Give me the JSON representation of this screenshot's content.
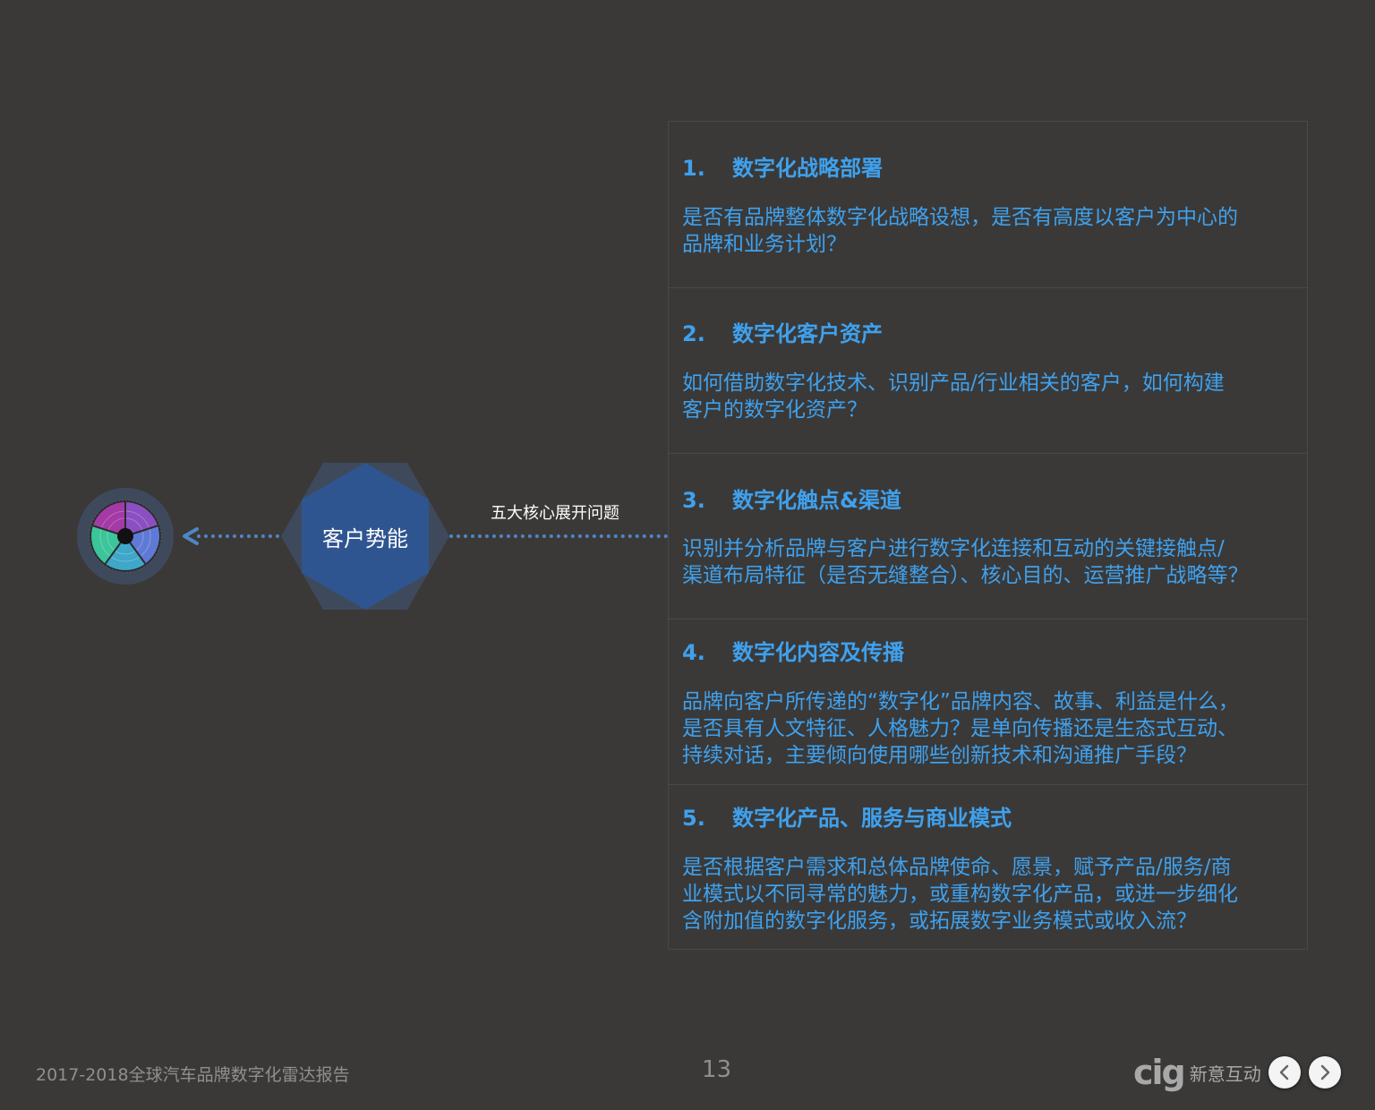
{
  "hub": {
    "label": "客户势能",
    "connector_caption": "五大核心展开问题"
  },
  "sections": [
    {
      "num": "1.",
      "title": "数字化战略部署",
      "body": "是否有品牌整体数字化战略设想，是否有高度以客户为中心的\n品牌和业务计划？"
    },
    {
      "num": "2.",
      "title": "数字化客户资产",
      "body": "如何借助数字化技术、识别产品/行业相关的客户，如何构建\n客户的数字化资产？"
    },
    {
      "num": "3.",
      "title": "数字化触点&渠道",
      "body": "识别并分析品牌与客户进行数字化连接和互动的关键接触点/\n渠道布局特征（是否无缝整合）、核心目的、运营推广战略等？"
    },
    {
      "num": "4.",
      "title": "数字化内容及传播",
      "body": "品牌向客户所传递的“数字化”品牌内容、故事、利益是什么，\n是否具有人文特征、人格魅力？是单向传播还是生态式互动、\n持续对话，主要倾向使用哪些创新技术和沟通推广手段？"
    },
    {
      "num": "5.",
      "title": "数字化产品、服务与商业模式",
      "body": "是否根据客户需求和总体品牌使命、愿景，赋予产品/服务/商\n业模式以不同寻常的魅力，或重构数字化产品，或进一步细化\n含附加值的数字化服务，或拓展数字业务模式或收入流？"
    }
  ],
  "footer": {
    "title": "2017-2018全球汽车品牌数字化雷达报告",
    "page": "13",
    "logo_mark": "cig",
    "logo_text": "新意互动"
  },
  "colors": {
    "background": "#3a3938",
    "accent_blue": "#3fa1ee",
    "hex_fill": "#2f5590",
    "hex_outer": "#3e4a5c",
    "connector": "#4f86c6"
  },
  "icons": {
    "prev": "chevron-left-icon",
    "next": "chevron-right-icon"
  }
}
